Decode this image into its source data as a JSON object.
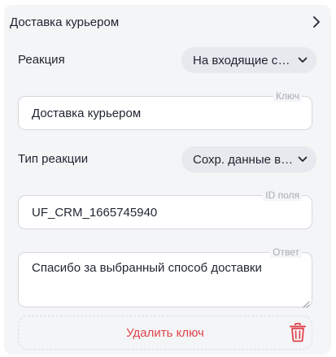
{
  "header": {
    "title": "Доставка курьером"
  },
  "reaction": {
    "label": "Реакция",
    "selected": "На входящие сообщения"
  },
  "key_field": {
    "tag": "Ключ",
    "value": "Доставка курьером"
  },
  "reaction_type": {
    "label": "Тип реакции",
    "selected": "Сохр. данные в поле"
  },
  "field_id": {
    "tag": "ID поля",
    "value": "UF_CRM_1665745940"
  },
  "answer": {
    "tag": "Ответ",
    "value": "Спасибо за выбранный способ доставки"
  },
  "delete": {
    "label": "Удалить ключ"
  },
  "icons": {
    "header_chevron": "chevron-right-icon",
    "select_chevron": "chevron-down-icon",
    "delete": "trash-icon",
    "resize": "resize-grip-icon"
  },
  "colors": {
    "panel_bg": "#f4f5f7",
    "select_bg": "#e7e9ee",
    "danger": "#e0434b",
    "muted_text": "#a7abb3"
  }
}
